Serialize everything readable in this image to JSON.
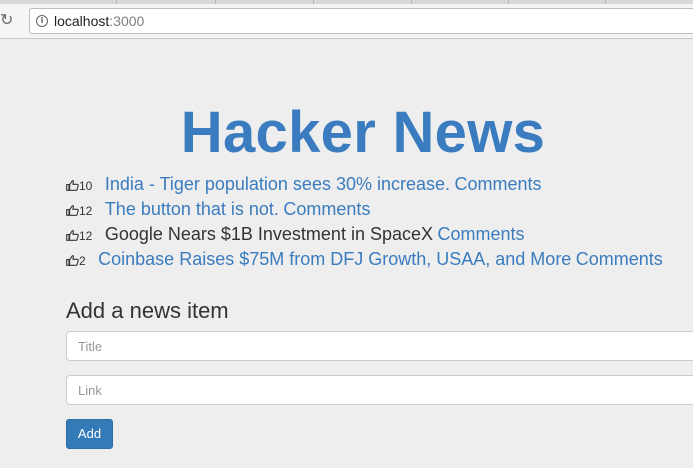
{
  "browser": {
    "url_host": "localhost",
    "url_port": ":3000",
    "reload_icon": "reload-icon",
    "info_icon": "info-icon"
  },
  "page": {
    "title": "Hacker News"
  },
  "news": [
    {
      "votes": "10",
      "title": "India - Tiger population sees 30% increase.",
      "title_is_link": true,
      "comments": "Comments"
    },
    {
      "votes": "12",
      "title": "The button that is not.",
      "title_is_link": true,
      "comments": "Comments"
    },
    {
      "votes": "12",
      "title": "Google Nears $1B Investment in SpaceX",
      "title_is_link": false,
      "comments": "Comments"
    },
    {
      "votes": "2",
      "title": "Coinbase Raises $75M from DFJ Growth, USAA, and More",
      "title_is_link": true,
      "comments": "Comments"
    }
  ],
  "form": {
    "heading": "Add a news item",
    "title_placeholder": "Title",
    "title_value": "",
    "link_placeholder": "Link",
    "link_value": "",
    "add_label": "Add"
  },
  "colors": {
    "link": "#3a7cbf",
    "button": "#337ab7",
    "background": "#eeeeee"
  }
}
